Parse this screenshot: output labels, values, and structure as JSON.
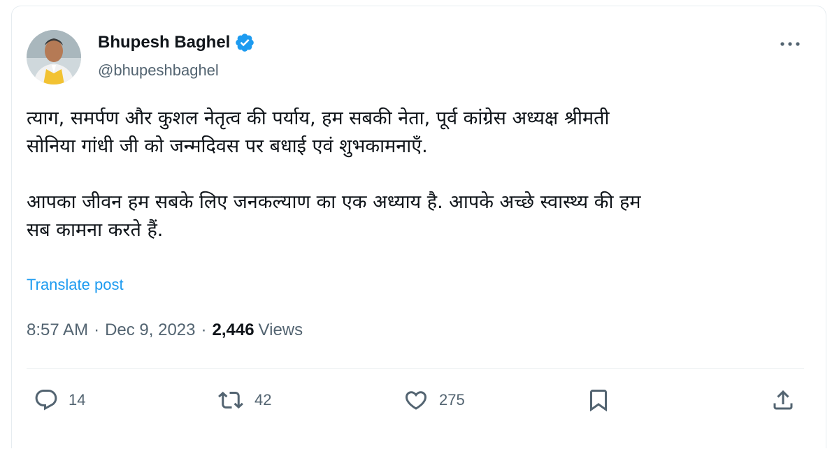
{
  "author": {
    "name": "Bhupesh Baghel",
    "handle": "@bhupeshbaghel"
  },
  "tweet": {
    "paragraph_1": "त्याग, समर्पण और कुशल नेतृत्व की पर्याय, हम सबकी नेता, पूर्व कांग्रेस अध्यक्ष श्रीमती\nसोनिया गांधी जी को जन्मदिवस पर बधाई एवं शुभकामनाएँ.",
    "paragraph_2": "आपका जीवन हम सबके लिए जनकल्याण का एक अध्याय है. आपके अच्छे स्वास्थ्य की हम\nसब कामना करते हैं."
  },
  "translate_label": "Translate post",
  "meta": {
    "time": "8:57 AM",
    "separator": "·",
    "date": "Dec 9, 2023",
    "views_count": "2,446",
    "views_label": "Views"
  },
  "actions": {
    "replies": "14",
    "reposts": "42",
    "likes": "275"
  },
  "icons": [
    "verified-badge-icon",
    "more-icon",
    "reply-icon",
    "repost-icon",
    "like-icon",
    "bookmark-icon",
    "share-icon"
  ],
  "colors": {
    "accent": "#1d9bf0",
    "text": "#0f1419",
    "secondary": "#536471",
    "vest": "#f2c232"
  }
}
